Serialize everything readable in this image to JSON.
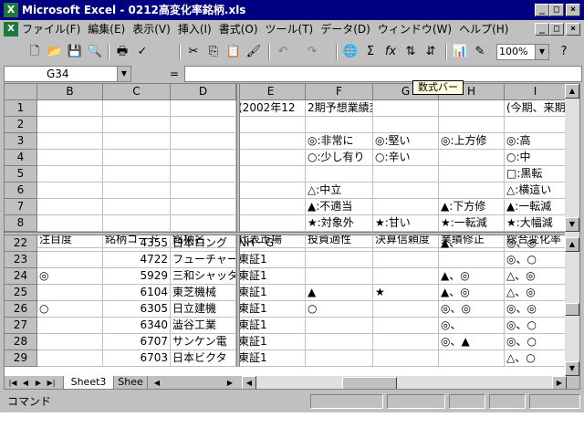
{
  "window": {
    "title": "Microsoft Excel - 0212高変化率銘柄.xls",
    "minimize": "_",
    "maximize": "□",
    "close": "×"
  },
  "menu": [
    {
      "label": "ファイル(F)"
    },
    {
      "label": "編集(E)"
    },
    {
      "label": "表示(V)"
    },
    {
      "label": "挿入(I)"
    },
    {
      "label": "書式(O)"
    },
    {
      "label": "ツール(T)"
    },
    {
      "label": "データ(D)"
    },
    {
      "label": "ウィンドウ(W)"
    },
    {
      "label": "ヘルプ(H)"
    }
  ],
  "toolbar": {
    "zoom": "100%",
    "icons": [
      "new-file-icon",
      "open-folder-icon",
      "save-icon",
      "print-preview-icon",
      "print-icon",
      "spell-check-icon",
      "cut-icon",
      "copy-icon",
      "paste-icon",
      "format-painter-icon",
      "undo-icon",
      "redo-icon",
      "hyperlink-icon",
      "autosum-icon",
      "function-icon",
      "sort-ascending-icon",
      "sort-descending-icon",
      "chart-wizard-icon",
      "drawing-icon",
      "help-icon"
    ]
  },
  "formula_bar": {
    "name_box": "G34",
    "equals": "=",
    "formula": ""
  },
  "tooltip": "数式バー",
  "sheet": {
    "col_headers": [
      "B",
      "C",
      "D",
      "E",
      "F",
      "G",
      "H",
      "I"
    ],
    "top_rows": [
      {
        "num": "1",
        "cells": [
          "",
          "",
          "",
          "(2002年12",
          "2期予想業績変化率表",
          "",
          "",
          "(今期、来期"
        ]
      },
      {
        "num": "2",
        "cells": [
          "",
          "",
          "",
          "",
          "",
          "",
          "",
          ""
        ]
      },
      {
        "num": "3",
        "cells": [
          "",
          "",
          "",
          "",
          "◎:非常に",
          "◎:堅い",
          "◎:上方修",
          "◎:高"
        ]
      },
      {
        "num": "4",
        "cells": [
          "",
          "",
          "",
          "",
          "○:少し有り",
          "○:辛い",
          "",
          "○:中"
        ]
      },
      {
        "num": "5",
        "cells": [
          "",
          "",
          "",
          "",
          "",
          "",
          "",
          "□:黒転"
        ]
      },
      {
        "num": "6",
        "cells": [
          "",
          "",
          "",
          "",
          "△:中立",
          "",
          "",
          "△:横這い"
        ]
      },
      {
        "num": "7",
        "cells": [
          "",
          "",
          "",
          "",
          "▲:不適当",
          "",
          "▲:下方修",
          "▲:一転減"
        ]
      },
      {
        "num": "8",
        "cells": [
          "",
          "",
          "",
          "",
          "★:対象外",
          "★:甘い",
          "★:一転減",
          "★:大幅減"
        ]
      },
      {
        "num": "9",
        "cells": [
          "注目度",
          "銘柄コード",
          "銘柄名",
          "代表市場",
          "投資適性",
          "決算信頼度",
          "業績修正",
          "総合変化率"
        ]
      }
    ],
    "bottom_rows": [
      {
        "num": "22",
        "cells": [
          "",
          "4355",
          "日本ロング",
          "NH－G",
          "",
          "",
          "▲、",
          "◎、◎"
        ]
      },
      {
        "num": "23",
        "cells": [
          "",
          "4722",
          "フューチャー",
          "東証1",
          "",
          "",
          "",
          "◎、○"
        ]
      },
      {
        "num": "24",
        "cells": [
          "◎",
          "5929",
          "三和シャッタ",
          "東証1",
          "",
          "",
          "▲、◎",
          "△、◎"
        ]
      },
      {
        "num": "25",
        "cells": [
          "",
          "6104",
          "東芝機械",
          "東証1",
          "▲",
          "★",
          "▲、◎",
          "△、◎"
        ]
      },
      {
        "num": "26",
        "cells": [
          "○",
          "6305",
          "日立建機",
          "東証1",
          "○",
          "",
          "◎、◎",
          "◎、◎"
        ]
      },
      {
        "num": "27",
        "cells": [
          "",
          "6340",
          "澁谷工業",
          "東証1",
          "",
          "",
          "◎、",
          "◎、○"
        ]
      },
      {
        "num": "28",
        "cells": [
          "",
          "6707",
          "サンケン電",
          "東証1",
          "",
          "",
          "◎、▲",
          "◎、○"
        ]
      },
      {
        "num": "29",
        "cells": [
          "",
          "6703",
          "日本ビクタ",
          "東証1",
          "",
          "",
          "",
          "△、○"
        ]
      }
    ]
  },
  "tabs": [
    {
      "label": "Sheet3"
    },
    {
      "label": "Shee"
    }
  ],
  "status": {
    "text": "コマンド"
  }
}
